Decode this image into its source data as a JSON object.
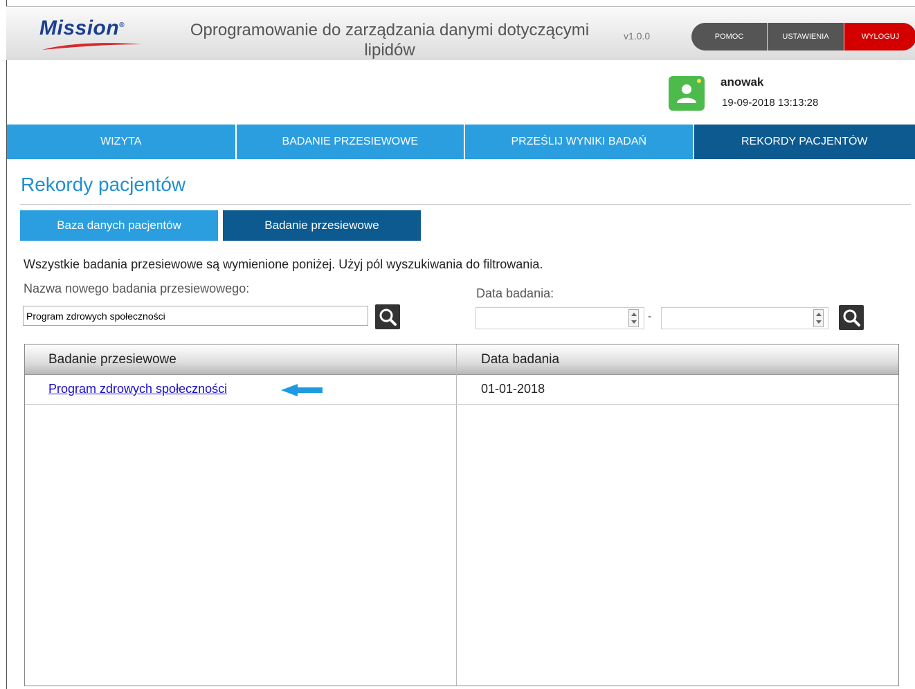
{
  "header": {
    "logo_text": "Mission",
    "logo_mark": "®",
    "title": "Oprogramowanie do zarządzania danymi dotyczącymi lipidów",
    "version": "v1.0.0",
    "buttons": {
      "help": "POMOC",
      "settings": "USTAWIENIA",
      "logout": "WYLOGUJ"
    },
    "colors": {
      "logout": "#d40000",
      "button": "#555555"
    }
  },
  "user": {
    "avatar_icon": "user-icon",
    "name": "anowak",
    "datetime": "19-09-2018 13:13:28"
  },
  "nav": {
    "tabs": [
      {
        "label": "WIZYTA",
        "active": false
      },
      {
        "label": "BADANIE PRZESIEWOWE",
        "active": false
      },
      {
        "label": "PRZEŚLIJ WYNIKI BADAŃ",
        "active": false
      },
      {
        "label": "REKORDY PACJENTÓW",
        "active": true
      }
    ],
    "colors": {
      "tab": "#2b9ee0",
      "active": "#0d5a91"
    }
  },
  "page": {
    "title": "Rekordy pacjentów",
    "subtabs": [
      {
        "label": "Baza danych pacjentów",
        "active": false
      },
      {
        "label": "Badanie przesiewowe",
        "active": true
      }
    ],
    "info": "Wszystkie badania przesiewowe są wymienione poniżej. Użyj pól wyszukiwania do filtrowania."
  },
  "search": {
    "name_label": "Nazwa nowego badania przesiewowego:",
    "name_value": "Program zdrowych społeczności",
    "date_label": "Data badania:",
    "date_from": "",
    "date_to": "",
    "separator": "-"
  },
  "table": {
    "headers": [
      "Badanie przesiewowe",
      "Data badania"
    ],
    "rows": [
      {
        "name": "Program zdrowych społeczności",
        "date": "01-01-2018"
      }
    ],
    "annotation_color": "#1e9be0"
  }
}
